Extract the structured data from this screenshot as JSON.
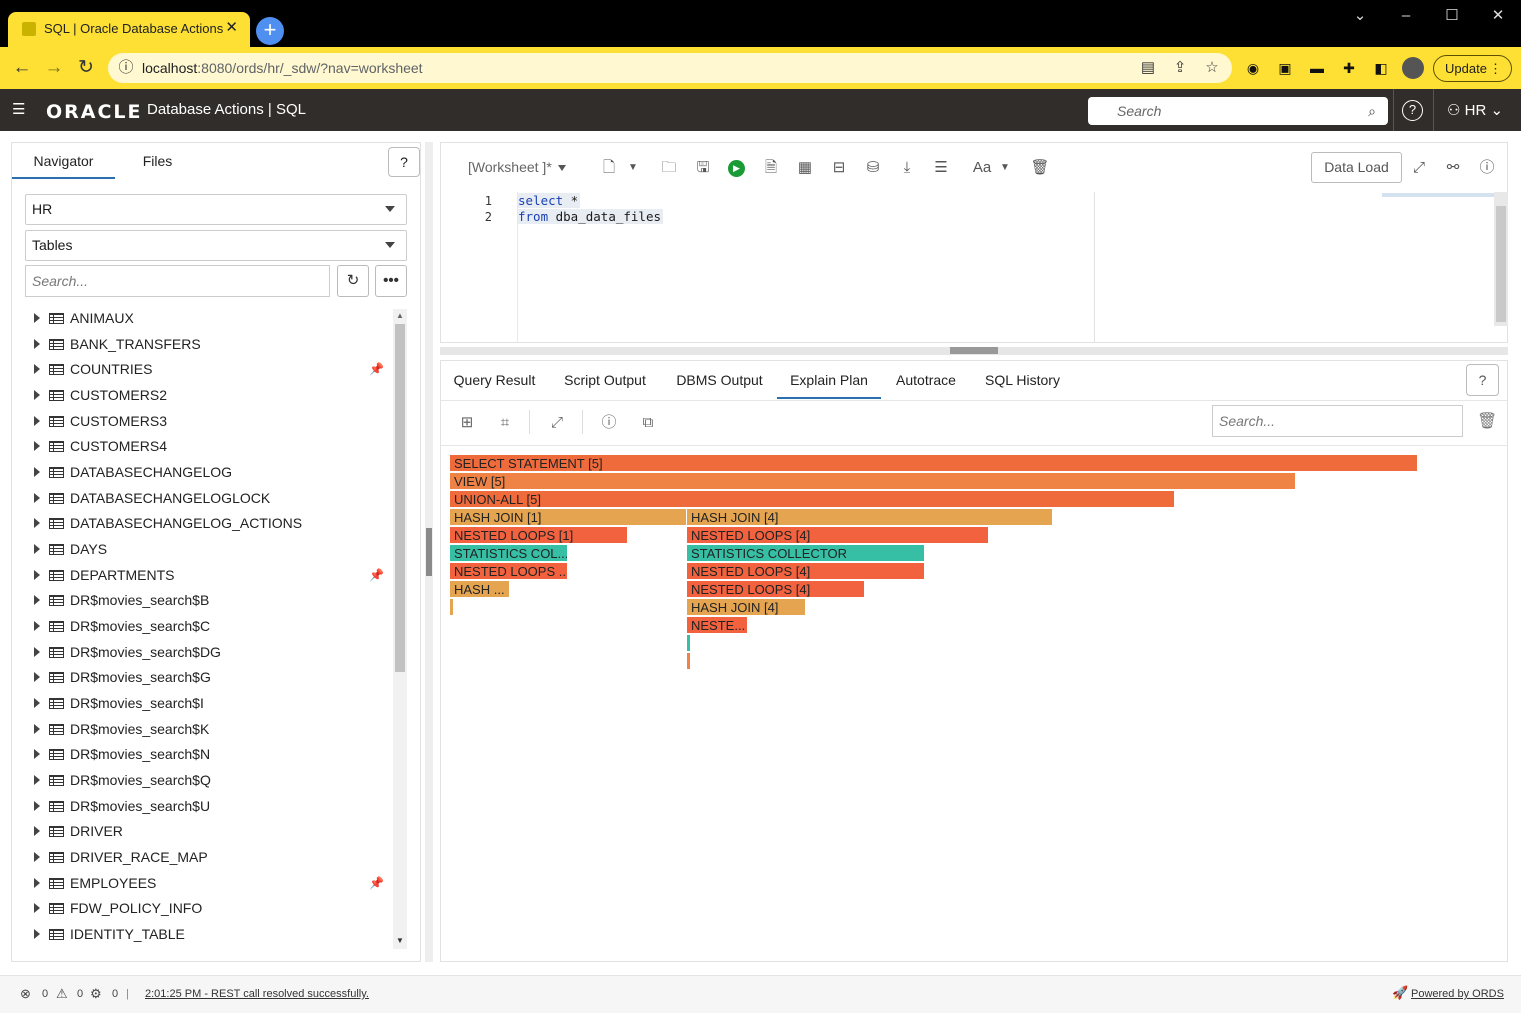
{
  "browser": {
    "tab_title": "SQL | Oracle Database Actions",
    "tab_close": "✕",
    "new_tab": "+",
    "url_host": "localhost",
    "url_path": ":8080/ords/hr/_sdw/?nav=worksheet",
    "update_label": "Update",
    "accent_color": "#fde033"
  },
  "header": {
    "logo": "ORACLE",
    "app_name": "Database Actions |  SQL",
    "search_placeholder": "Search",
    "user": "HR"
  },
  "navigator": {
    "tabs": [
      "Navigator",
      "Files"
    ],
    "schema": "HR",
    "object_type": "Tables",
    "search_placeholder": "Search...",
    "tables": [
      {
        "name": "ANIMAUX",
        "pinned": false
      },
      {
        "name": "BANK_TRANSFERS",
        "pinned": false
      },
      {
        "name": "COUNTRIES",
        "pinned": true
      },
      {
        "name": "CUSTOMERS2",
        "pinned": false
      },
      {
        "name": "CUSTOMERS3",
        "pinned": false
      },
      {
        "name": "CUSTOMERS4",
        "pinned": false
      },
      {
        "name": "DATABASECHANGELOG",
        "pinned": false
      },
      {
        "name": "DATABASECHANGELOGLOCK",
        "pinned": false
      },
      {
        "name": "DATABASECHANGELOG_ACTIONS",
        "pinned": false
      },
      {
        "name": "DAYS",
        "pinned": false
      },
      {
        "name": "DEPARTMENTS",
        "pinned": true
      },
      {
        "name": "DR$movies_search$B",
        "pinned": false
      },
      {
        "name": "DR$movies_search$C",
        "pinned": false
      },
      {
        "name": "DR$movies_search$DG",
        "pinned": false
      },
      {
        "name": "DR$movies_search$G",
        "pinned": false
      },
      {
        "name": "DR$movies_search$I",
        "pinned": false
      },
      {
        "name": "DR$movies_search$K",
        "pinned": false
      },
      {
        "name": "DR$movies_search$N",
        "pinned": false
      },
      {
        "name": "DR$movies_search$Q",
        "pinned": false
      },
      {
        "name": "DR$movies_search$U",
        "pinned": false
      },
      {
        "name": "DRIVER",
        "pinned": false
      },
      {
        "name": "DRIVER_RACE_MAP",
        "pinned": false
      },
      {
        "name": "EMPLOYEES",
        "pinned": true
      },
      {
        "name": "FDW_POLICY_INFO",
        "pinned": false
      },
      {
        "name": "IDENTITY_TABLE",
        "pinned": false
      }
    ]
  },
  "worksheet": {
    "name": "[Worksheet ]*",
    "data_load_label": "Data Load",
    "code_lines": [
      {
        "num": "1",
        "keyword": "select",
        "rest": " *"
      },
      {
        "num": "2",
        "keyword": "from",
        "rest": " dba_data_files"
      }
    ]
  },
  "results": {
    "tabs": [
      "Query Result",
      "Script Output",
      "DBMS Output",
      "Explain Plan",
      "Autotrace",
      "SQL History"
    ],
    "active_tab": "Explain Plan",
    "search_placeholder": "Search...",
    "plan_nodes": [
      {
        "label": "SELECT STATEMENT [5]",
        "color": "#f06b3c"
      },
      {
        "label": "VIEW [5]",
        "color": "#ef8346"
      },
      {
        "label": "UNION-ALL [5]",
        "color": "#f06b3c"
      },
      {
        "label": "HASH JOIN [1]",
        "color": "#e5a550"
      },
      {
        "label": "HASH JOIN [4]",
        "color": "#e5a550"
      },
      {
        "label": "NESTED LOOPS [1]",
        "color": "#f2623f"
      },
      {
        "label": "NESTED LOOPS [4]",
        "color": "#f2623f"
      },
      {
        "label": "STATISTICS COL...",
        "color": "#36bfa5"
      },
      {
        "label": "STATISTICS COLLECTOR",
        "color": "#36bfa5"
      },
      {
        "label": "NESTED LOOPS ...",
        "color": "#f2623f"
      },
      {
        "label": "NESTED LOOPS [4]",
        "color": "#f2623f"
      },
      {
        "label": "HASH ...",
        "color": "#e5a550"
      },
      {
        "label": "NESTED LOOPS [4]",
        "color": "#f2623f"
      },
      {
        "label": "HASH JOIN [4]",
        "color": "#e5a550"
      },
      {
        "label": "NESTE...",
        "color": "#f2623f"
      },
      {
        "label": "",
        "color": "#e5a550"
      },
      {
        "label": "",
        "color": "#36bfa5"
      },
      {
        "label": "",
        "color": "#ef8346"
      }
    ]
  },
  "status": {
    "errors": "0",
    "warnings": "0",
    "jobs": "0",
    "message": "2:01:25 PM - REST call resolved successfully.",
    "powered_by": "Powered by ORDS"
  }
}
